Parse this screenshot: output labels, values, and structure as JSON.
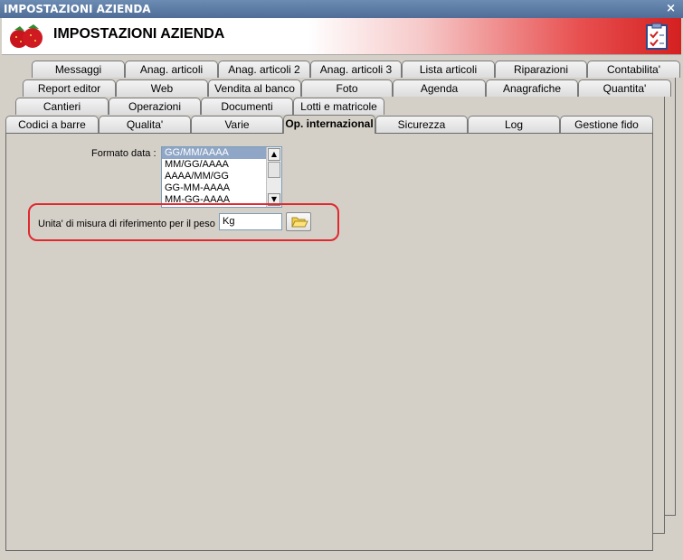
{
  "window": {
    "title": "IMPOSTAZIONI AZIENDA",
    "close_glyph": "×"
  },
  "header": {
    "title": "IMPOSTAZIONI AZIENDA",
    "logo_icon": "strawberry-logo-icon",
    "right_icon": "checklist-icon"
  },
  "tabs": {
    "row1": [
      "Messaggi",
      "Anag. articoli",
      "Anag. articoli 2",
      "Anag. articoli 3",
      "Lista articoli",
      "Riparazioni",
      "Contabilita'"
    ],
    "row2": [
      "Report editor",
      "Web",
      "Vendita al banco",
      "Foto",
      "Agenda",
      "Anagrafiche",
      "Quantita'"
    ],
    "row3": [
      "Cantieri",
      "Operazioni",
      "Documenti",
      "Lotti e matricole"
    ],
    "row4": [
      "Codici a barre",
      "Qualita'",
      "Varie",
      "Op. internazional",
      "Sicurezza",
      "Log",
      "Gestione fido"
    ],
    "active": "Op. internazional"
  },
  "form": {
    "date_format_label": "Formato data :",
    "date_formats": [
      "GG/MM/AAAA",
      "MM/GG/AAAA",
      "AAAA/MM/GG",
      "GG-MM-AAAA",
      "MM-GG-AAAA"
    ],
    "date_format_selected": "GG/MM/AAAA",
    "weight_unit_label": "Unita' di misura di riferimento per il peso :",
    "weight_unit_value": "Kg"
  },
  "colors": {
    "titlebar": "#5b7aa3",
    "highlight": "#e0282e",
    "selection": "#8fa6c6"
  }
}
